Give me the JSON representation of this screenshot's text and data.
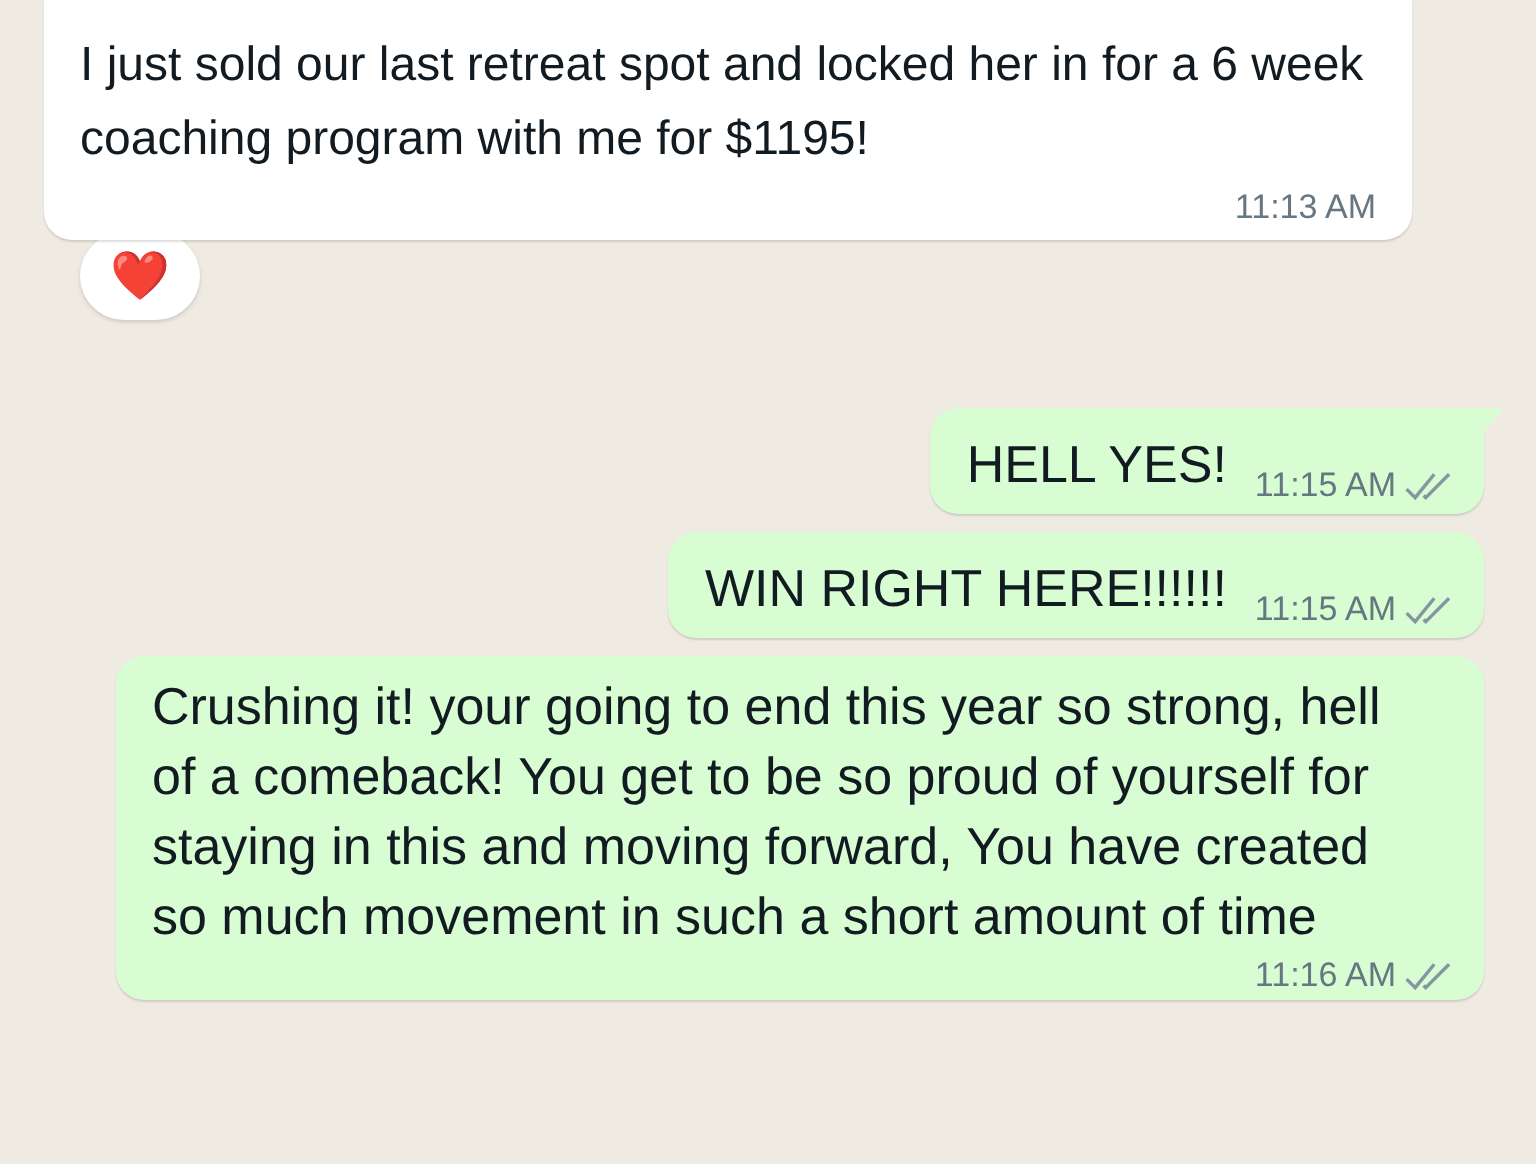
{
  "messages": [
    {
      "kind": "incoming",
      "text": "I just sold our last retreat spot and locked her in for a 6 week coaching program with me for $1195!",
      "time": "11:13 AM",
      "reaction": "❤️"
    },
    {
      "kind": "outgoing",
      "text": "HELL YES!",
      "time": "11:15 AM",
      "read": false,
      "tail": true
    },
    {
      "kind": "outgoing",
      "text": "WIN RIGHT HERE!!!!!!",
      "time": "11:15 AM",
      "read": false,
      "tail": false
    },
    {
      "kind": "outgoing",
      "text": "Crushing it! your going to end this year so strong, hell of a comeback! You get to be so proud of yourself for staying in this and moving forward, You have created so much movement in such a short amount of time",
      "time": "11:16 AM",
      "read": false,
      "tail": false,
      "long": true
    }
  ]
}
